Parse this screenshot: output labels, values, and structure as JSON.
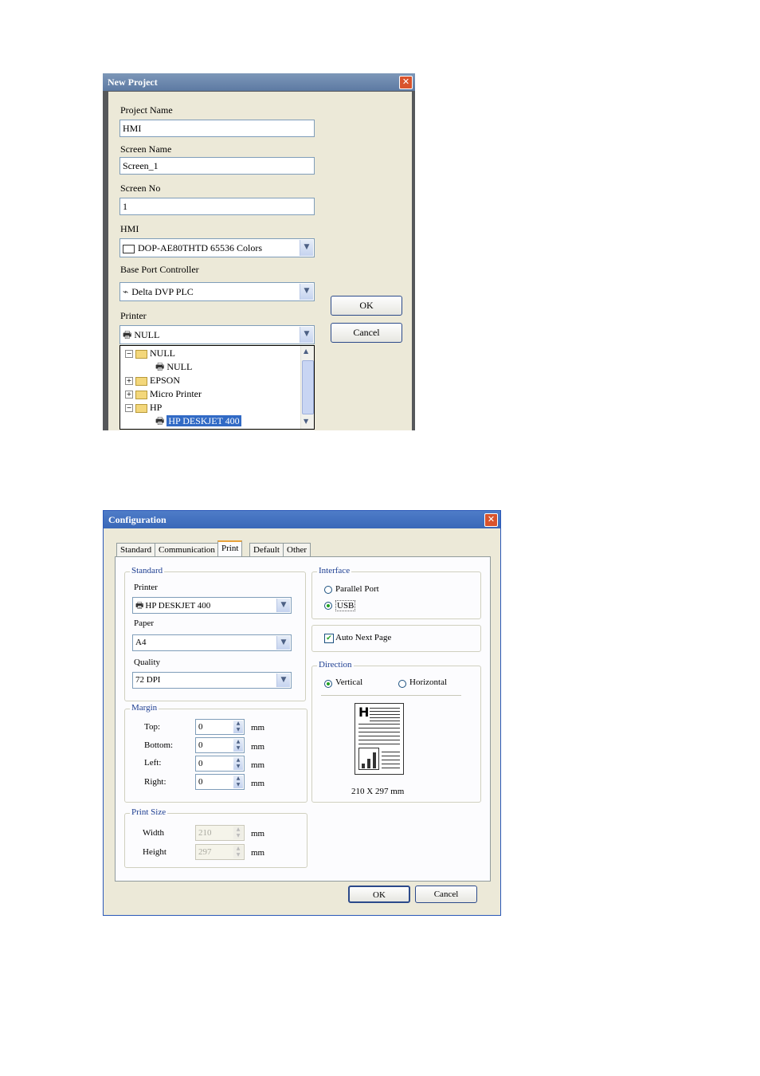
{
  "new_project": {
    "title": "New Project",
    "close_glyph": "✕",
    "project_name_label": "Project Name",
    "project_name_value": "HMI",
    "screen_name_label": "Screen Name",
    "screen_name_value": "Screen_1",
    "screen_no_label": "Screen No",
    "screen_no_value": "1",
    "hmi_label": "HMI",
    "hmi_value": "DOP-AE80THTD 65536 Colors",
    "base_port_label": "Base Port Controller",
    "base_port_value": "Delta DVP PLC",
    "printer_label": "Printer",
    "printer_value": "NULL",
    "ok_label": "OK",
    "cancel_label": "Cancel",
    "tree": [
      {
        "label": "NULL",
        "level": 0,
        "expander": "−",
        "kind": "folder-open"
      },
      {
        "label": "NULL",
        "level": 1,
        "kind": "printer"
      },
      {
        "label": "EPSON",
        "level": 0,
        "expander": "+",
        "kind": "folder"
      },
      {
        "label": "Micro Printer",
        "level": 0,
        "expander": "+",
        "kind": "folder"
      },
      {
        "label": "HP",
        "level": 0,
        "expander": "−",
        "kind": "folder-open"
      },
      {
        "label": "HP DESKJET 400",
        "level": 1,
        "kind": "printer",
        "selected": true
      }
    ]
  },
  "configuration": {
    "title": "Configuration",
    "tabs": [
      "Standard",
      "Communication",
      "Print",
      "Default",
      "Other"
    ],
    "active_tab": "Print",
    "standard_group": "Standard",
    "printer_label": "Printer",
    "printer_value": "HP DESKJET 400",
    "paper_label": "Paper",
    "paper_value": "A4",
    "quality_label": "Quality",
    "quality_value": "72 DPI",
    "margin_group": "Margin",
    "margins": [
      {
        "label": "Top:",
        "value": "0",
        "unit": "mm"
      },
      {
        "label": "Bottom:",
        "value": "0",
        "unit": "mm"
      },
      {
        "label": "Left:",
        "value": "0",
        "unit": "mm"
      },
      {
        "label": "Right:",
        "value": "0",
        "unit": "mm"
      }
    ],
    "print_size_group": "Print Size",
    "width_label": "Width",
    "width_value": "210",
    "height_label": "Height",
    "height_value": "297",
    "mm": "mm",
    "interface_group": "Interface",
    "parallel_label": "Parallel Port",
    "usb_label": "USB",
    "interface_selected": "USB",
    "auto_next_label": "Auto Next Page",
    "auto_next_checked": true,
    "direction_group": "Direction",
    "vertical_label": "Vertical",
    "horizontal_label": "Horizontal",
    "direction_selected": "Vertical",
    "page_preview_letter": "H",
    "page_size_text": "210 X 297 mm",
    "ok_label": "OK",
    "cancel_label": "Cancel"
  },
  "icons": {
    "dropdown": "▼",
    "scroll_up": "▲",
    "scroll_down": "▼",
    "spin_up": "▲",
    "spin_down": "▼",
    "check": "✔"
  }
}
